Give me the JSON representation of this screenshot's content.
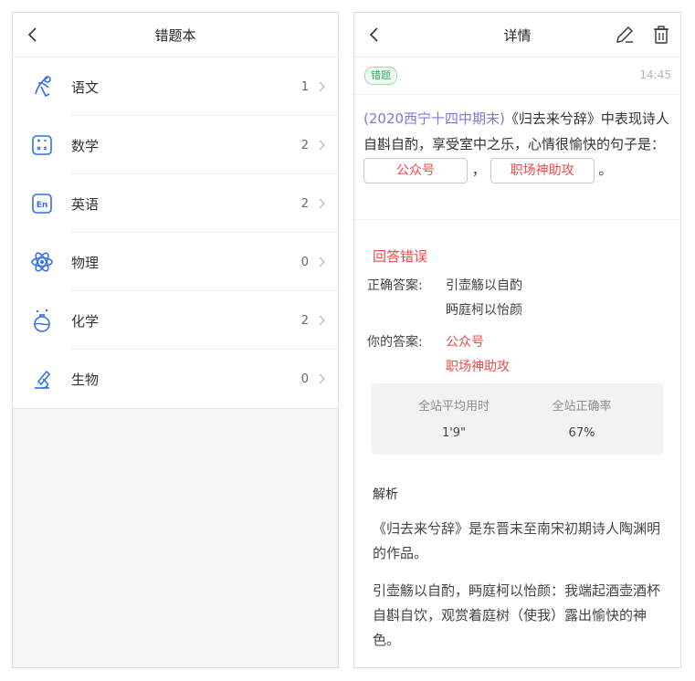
{
  "left": {
    "title": "错题本",
    "subjects": [
      {
        "label": "语文",
        "count": "1",
        "icon": "literature-icon"
      },
      {
        "label": "数学",
        "count": "2",
        "icon": "math-icon"
      },
      {
        "label": "英语",
        "count": "2",
        "icon": "english-icon",
        "icon_text": "En"
      },
      {
        "label": "物理",
        "count": "0",
        "icon": "atom-icon"
      },
      {
        "label": "化学",
        "count": "2",
        "icon": "flask-icon"
      },
      {
        "label": "生物",
        "count": "0",
        "icon": "microscope-icon"
      }
    ]
  },
  "right": {
    "title": "详情",
    "tag": "错题",
    "time": "14:45",
    "question": {
      "source": "(2020西宁十四中期末)",
      "text_before": "《归去来兮辞》中表现诗人自斟自酌，享受室中之乐，心情很愉快的句子是：",
      "blank1": "公众号",
      "separator": "，",
      "blank2": "职场神助攻",
      "end": "。"
    },
    "result": "回答错误",
    "correct_label": "正确答案:",
    "correct_answers": [
      "引壶觞以自酌",
      "眄庭柯以怡颜"
    ],
    "your_label": "你的答案:",
    "your_answers": [
      "公众号",
      "职场神助攻"
    ],
    "stats": {
      "avg_time_label": "全站平均用时",
      "avg_time_value": "1'9\"",
      "accuracy_label": "全站正确率",
      "accuracy_value": "67%"
    },
    "analysis_title": "解析",
    "analysis_p1": "《归去来兮辞》是东晋末至南宋初期诗人陶渊明的作品。",
    "analysis_p2": "引壶觞以自酌，眄庭柯以怡颜：我端起酒壶酒杯自斟自饮，观赏着庭树（使我）露出愉快的神色。"
  },
  "colors": {
    "accent_blue": "#2f6fe8",
    "error_red": "#f04848",
    "tag_green": "#3aa65f",
    "source_purple": "#7b78d6"
  }
}
